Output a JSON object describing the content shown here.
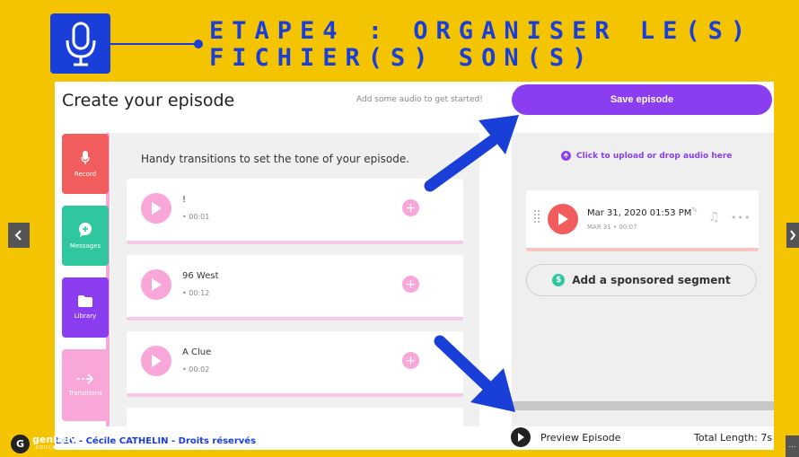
{
  "header": {
    "title": "ETAPE4 : ORGANISER LE(S) FICHIER(S) SON(S)",
    "icon": "microphone-icon"
  },
  "editor": {
    "title": "Create your episode",
    "hint": "Add some audio to get started!",
    "save_label": "Save episode"
  },
  "sidebar": {
    "items": [
      {
        "label": "Record",
        "icon": "microphone-icon"
      },
      {
        "label": "Messages",
        "icon": "message-plus-icon"
      },
      {
        "label": "Library",
        "icon": "folder-icon"
      },
      {
        "label": "Transitions",
        "icon": "transition-arrow-icon"
      }
    ]
  },
  "transitions": {
    "heading": "Handy transitions to set the tone of your episode.",
    "items": [
      {
        "name": "!",
        "duration": "• 00:01"
      },
      {
        "name": "96 West",
        "duration": "• 00:12"
      },
      {
        "name": "A Clue",
        "duration": "• 00:02"
      }
    ]
  },
  "episode": {
    "upload_label": "Click to upload or drop audio here",
    "segment_title": "Mar 31, 2020 01:53 PM",
    "segment_meta": "MAR 31 • 00:07",
    "sponsor_label": "Add a sponsored segment"
  },
  "footer": {
    "credit": "DEC - Cécile CATHELIN - Droits réservés",
    "preview_label": "Preview Episode",
    "total_length": "Total Length: 7s"
  },
  "brand": {
    "name": "genially",
    "sub": "EDUCATION"
  },
  "colors": {
    "background": "#f5c400",
    "accent_blue": "#1a3fd8",
    "purple": "#8b3df0",
    "record_red": "#f15c5c",
    "messages_teal": "#2fc7a0",
    "transitions_pink": "#f9a6d9"
  }
}
